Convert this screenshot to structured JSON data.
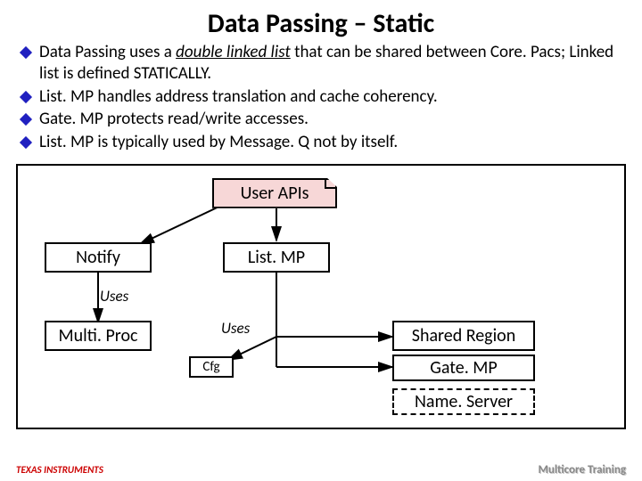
{
  "title": "Data Passing – Static",
  "bullets": {
    "b0_pre": "Data Passing uses a ",
    "b0_em": "double linked list",
    "b0_post": " that can be shared between Core. Pacs; Linked list is defined STATICALLY.",
    "b1": "List. MP handles address translation and cache coherency.",
    "b2": "Gate. MP protects read/write accesses.",
    "b3": "List. MP is typically used by Message. Q not by itself."
  },
  "diagram": {
    "user_apis": "User APIs",
    "notify": "Notify",
    "listmp": "List. MP",
    "multiproc": "Multi. Proc",
    "shared_region": "Shared Region",
    "gatemp": "Gate. MP",
    "nameserver": "Name. Server",
    "cfg": "Cfg",
    "uses1": "Uses",
    "uses2": "Uses"
  },
  "footer": {
    "ti": "TEXAS INSTRUMENTS",
    "mct": "Multicore Training"
  }
}
